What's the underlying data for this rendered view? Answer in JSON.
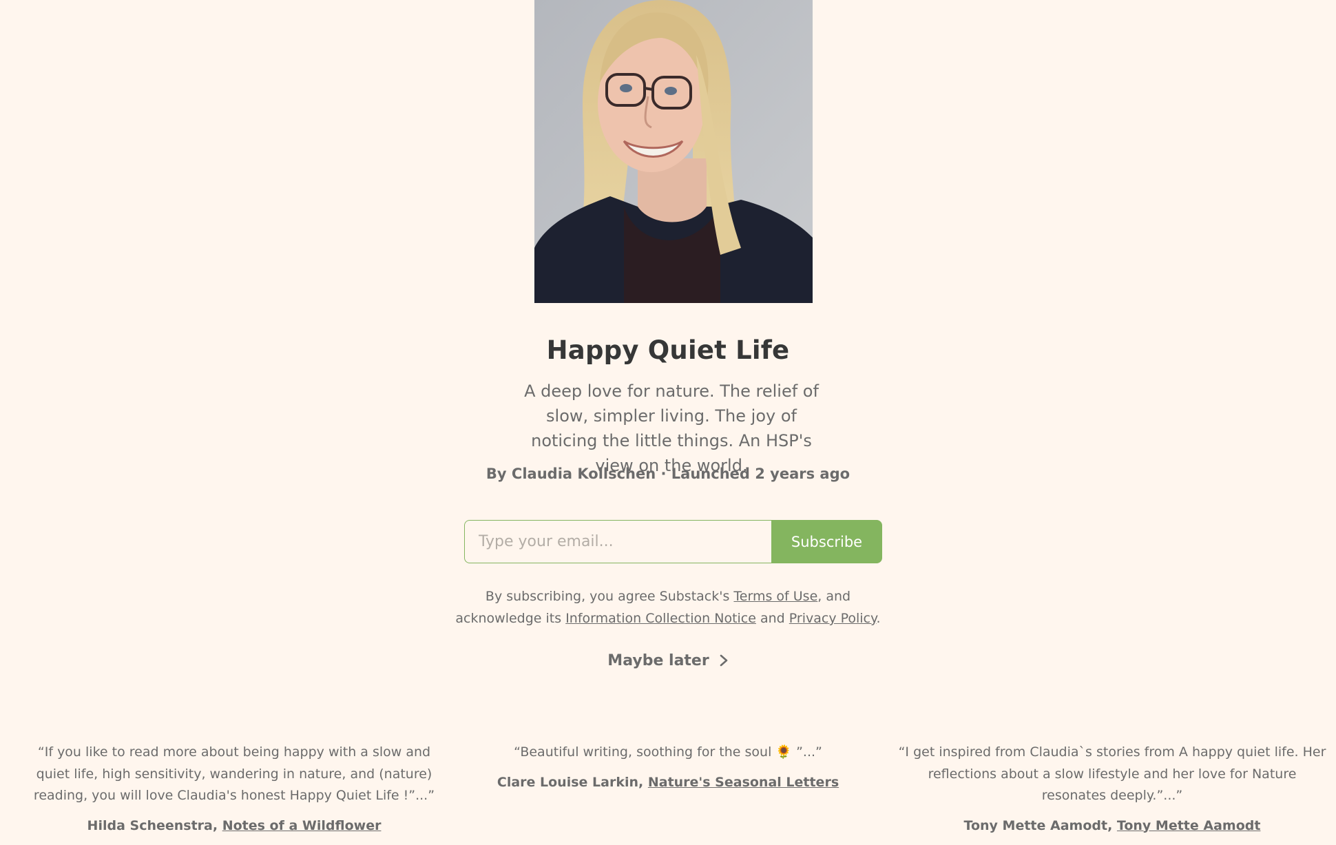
{
  "publication": {
    "title": "Happy Quiet Life",
    "description": "A deep love for nature. The relief of slow, simpler living. The joy of noticing the little things. An HSP's view on the world.",
    "byline": "By Claudia Kollschen · Launched 2 years ago"
  },
  "subscribe": {
    "email_placeholder": "Type your email...",
    "button_label": "Subscribe"
  },
  "terms": {
    "prefix": "By subscribing, you agree Substack's ",
    "terms_link": "Terms of Use",
    "middle": ", and acknowledge its ",
    "info_link": "Information Collection Notice",
    "and": " and ",
    "privacy_link": "Privacy Policy",
    "suffix": "."
  },
  "maybe_later": {
    "label": "Maybe later",
    "icon": "chevron-right-icon"
  },
  "testimonials": [
    {
      "quote": "“If you like to read more about being happy with a slow and quiet life, high sensitivity, wandering in nature, and (nature) reading, you will love Claudia's honest Happy Quiet Life !”...”",
      "author": "Hilda Scheenstra, ",
      "publication": "Notes of a Wildflower"
    },
    {
      "quote": "“Beautiful writing, soothing for the soul 🌻 ”...”",
      "author": "Clare Louise Larkin, ",
      "publication": "Nature's Seasonal Letters"
    },
    {
      "quote": "“I get inspired from Claudia`s stories from A happy quiet life. Her reflections about a slow lifestyle and her love for Nature resonates deeply.”...”",
      "author": "Tony Mette Aamodt, ",
      "publication": "Tony Mette Aamodt"
    }
  ],
  "colors": {
    "background": "#FFF6EE",
    "accent": "#84B55F",
    "text_primary": "#363737",
    "text_secondary": "#6B6B6B"
  }
}
